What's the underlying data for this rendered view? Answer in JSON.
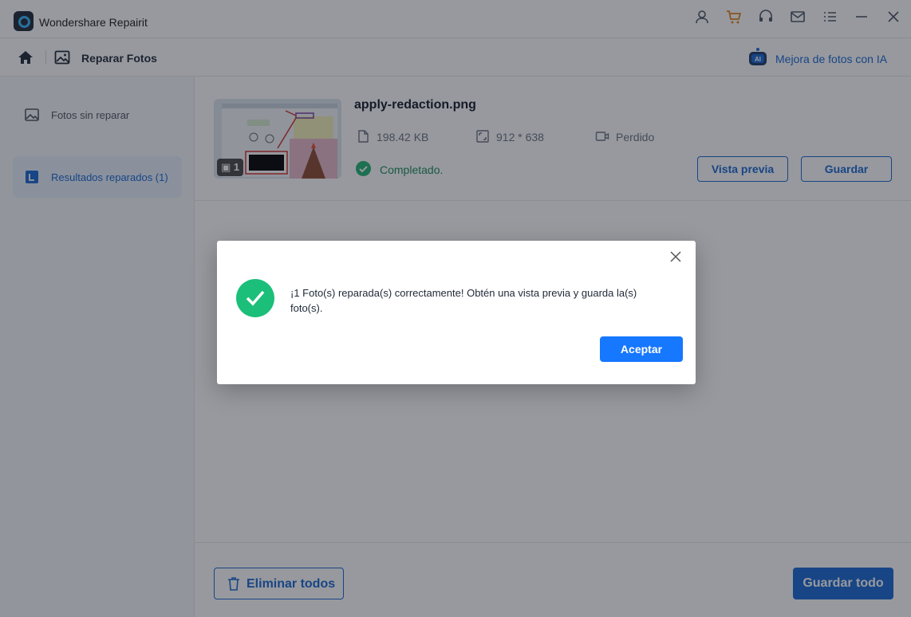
{
  "app": {
    "title": "Wondershare Repairit"
  },
  "titlebar_icons": [
    "user-icon",
    "cart-icon",
    "headset-icon",
    "mail-icon",
    "menu-icon",
    "minimize-icon",
    "close-icon"
  ],
  "nav": {
    "title": "Reparar Fotos",
    "ai_link": "Mejora de fotos con IA",
    "ai_badge": "AI"
  },
  "sidebar": {
    "items": [
      {
        "label": "Fotos sin reparar",
        "icon": "image-icon",
        "active": false
      },
      {
        "label": "Resultados reparados (1)",
        "icon": "bookmark-icon",
        "active": true
      }
    ]
  },
  "result": {
    "file_name": "apply-redaction.png",
    "size": "198.42  KB",
    "dimensions": "912 * 638",
    "camera": "Perdido",
    "status": "Completado.",
    "thumb_count": "1",
    "preview_label": "Vista previa",
    "save_label": "Guardar"
  },
  "footer": {
    "delete_all_label": "Eliminar todos",
    "save_all_label": "Guardar todo"
  },
  "modal": {
    "message": "¡1 Foto(s) reparada(s) correctamente! Obtén una vista previa y guarda la(s) foto(s).",
    "ok_label": "Aceptar"
  },
  "colors": {
    "accent": "#1967d2",
    "success": "#1bbf79",
    "cart": "#e8821c",
    "ok_button": "#1677ff"
  }
}
